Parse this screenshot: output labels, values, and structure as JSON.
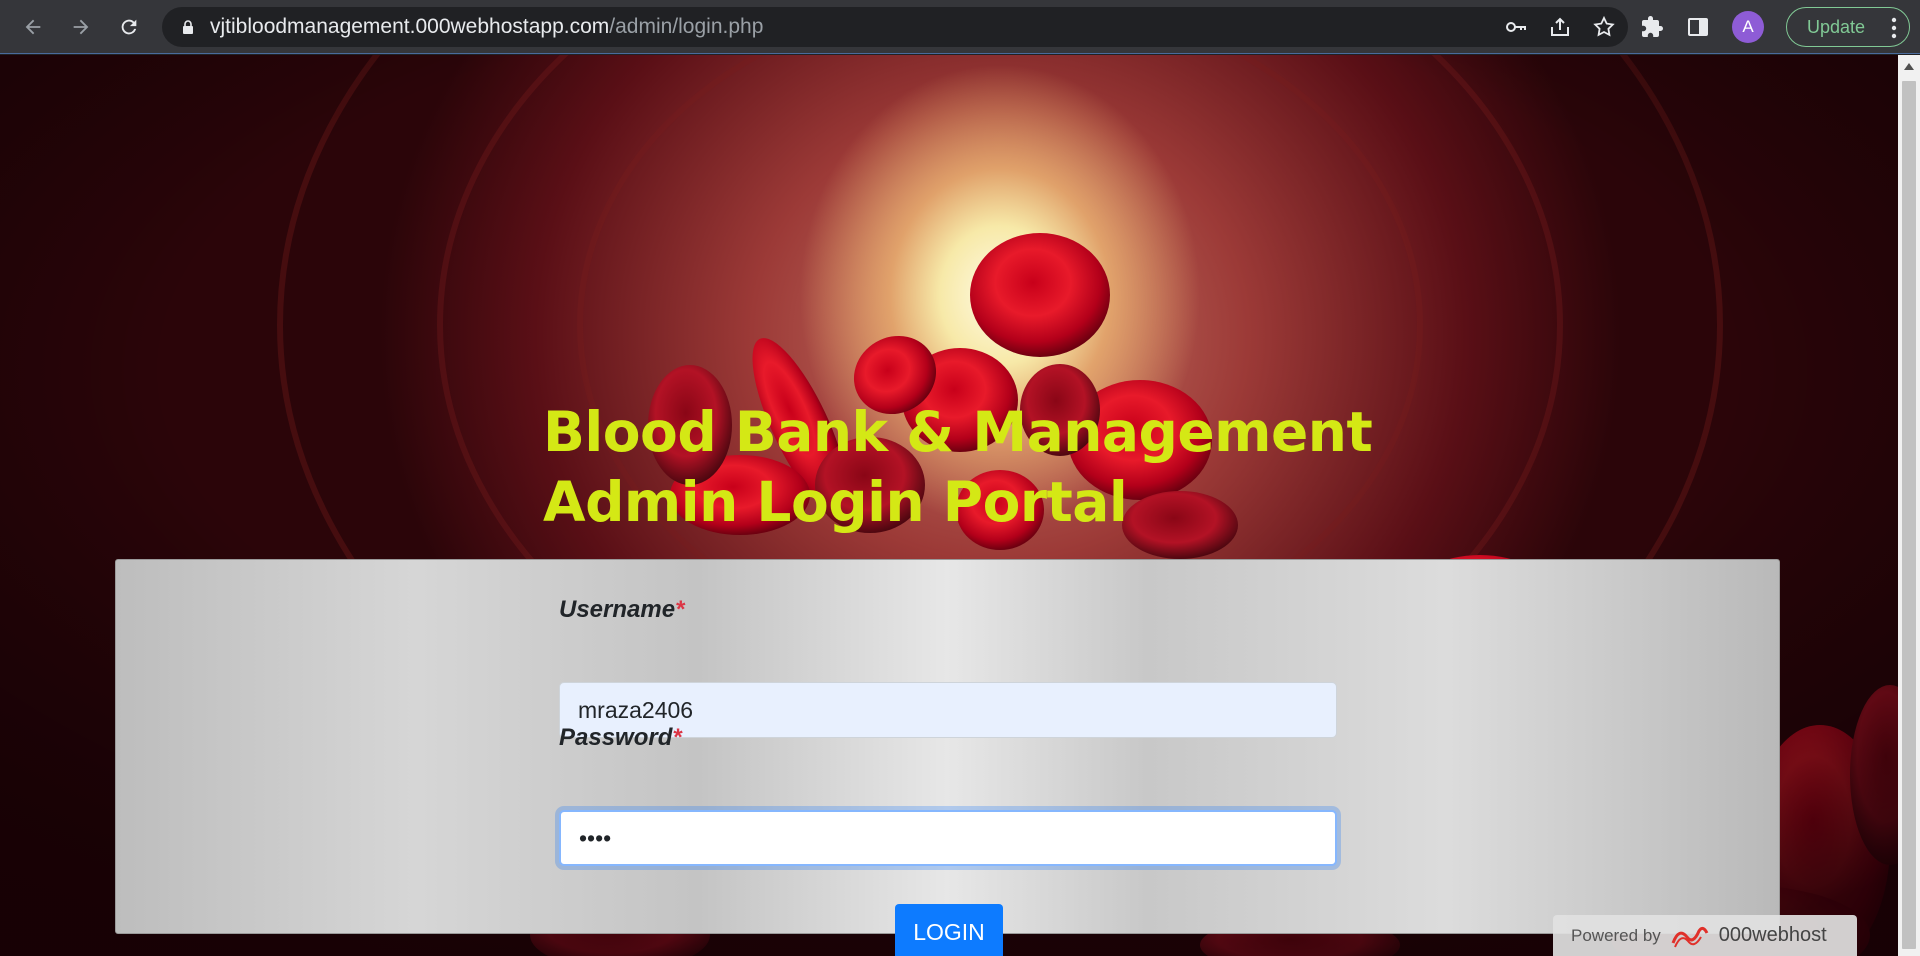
{
  "browser": {
    "url_host": "vjtibloodmanagement.000webhostapp.com",
    "url_path": "/admin/login.php",
    "avatar_letter": "A",
    "update_label": "Update",
    "icons": {
      "back": "arrow-left-icon",
      "forward": "arrow-right-icon",
      "reload": "reload-icon",
      "lock": "lock-icon",
      "password_key": "key-icon",
      "share": "share-icon",
      "bookmark": "star-icon",
      "extensions": "puzzle-icon",
      "side_panel": "side-panel-icon",
      "menu": "kebab-menu-icon"
    }
  },
  "page": {
    "title_line1": "Blood Bank & Management",
    "title_line2": "Admin Login Portal",
    "title_color": "#d4e815",
    "form": {
      "username_label": "Username",
      "username_value": "mraza2406",
      "password_label": "Password",
      "password_value": "••••",
      "required_marker": "*",
      "login_label": "LOGIN"
    },
    "footer": {
      "powered_by": "Powered by",
      "brand": "000webhost"
    }
  },
  "colors": {
    "accent_button": "#0d7bff",
    "required": "#dc3545",
    "update_green": "#81c995"
  }
}
